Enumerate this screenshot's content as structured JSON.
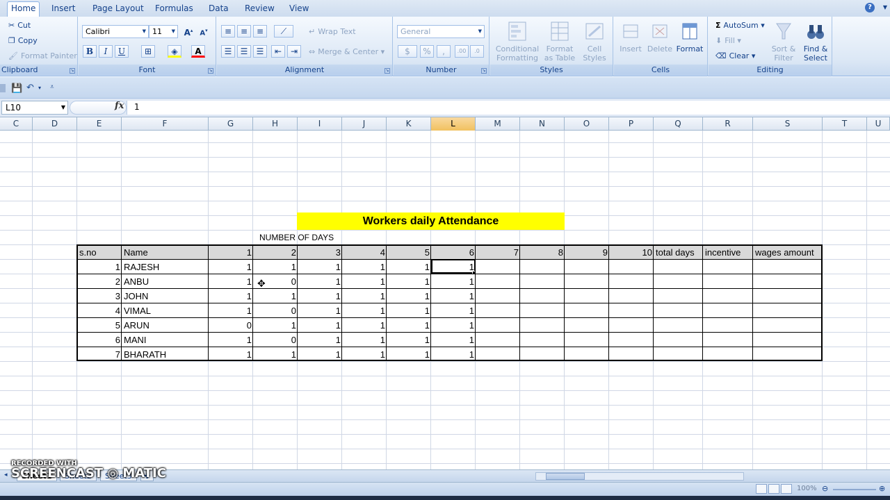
{
  "ribbon_tabs": [
    "Home",
    "Insert",
    "Page Layout",
    "Formulas",
    "Data",
    "Review",
    "View"
  ],
  "clipboard": {
    "cut": "Cut",
    "copy": "Copy",
    "format_painter": "Format Painter",
    "label": "Clipboard"
  },
  "font": {
    "name": "Calibri",
    "size": "11",
    "label": "Font",
    "bold": "B",
    "italic": "I",
    "underline": "U"
  },
  "alignment": {
    "wrap_text": "Wrap Text",
    "merge_center": "Merge & Center",
    "label": "Alignment"
  },
  "number": {
    "format": "General",
    "currency": "$",
    "percent": "%",
    "comma": ",",
    "label": "Number"
  },
  "styles": {
    "conditional": "Conditional\nFormatting",
    "format_table": "Format\nas Table",
    "cell_styles": "Cell\nStyles",
    "label": "Styles"
  },
  "cells": {
    "insert": "Insert",
    "delete": "Delete",
    "format": "Format",
    "label": "Cells"
  },
  "editing": {
    "autosum": "AutoSum",
    "fill": "Fill",
    "clear": "Clear",
    "sort_filter": "Sort &\nFilter",
    "find_select": "Find &\nSelect",
    "label": "Editing"
  },
  "formula_bar": {
    "name_box": "L10",
    "fx": "fx",
    "value": "1"
  },
  "column_headers": [
    {
      "id": "C",
      "sel": false
    },
    {
      "id": "D",
      "sel": false
    },
    {
      "id": "E",
      "sel": false
    },
    {
      "id": "F",
      "sel": false
    },
    {
      "id": "G",
      "sel": false
    },
    {
      "id": "H",
      "sel": false
    },
    {
      "id": "I",
      "sel": false
    },
    {
      "id": "J",
      "sel": false
    },
    {
      "id": "K",
      "sel": false
    },
    {
      "id": "L",
      "sel": true
    },
    {
      "id": "M",
      "sel": false
    },
    {
      "id": "N",
      "sel": false
    },
    {
      "id": "O",
      "sel": false
    },
    {
      "id": "P",
      "sel": false
    },
    {
      "id": "Q",
      "sel": false
    },
    {
      "id": "R",
      "sel": false
    },
    {
      "id": "S",
      "sel": false
    },
    {
      "id": "T",
      "sel": false
    },
    {
      "id": "U",
      "sel": false
    }
  ],
  "sheet": {
    "title": "Workers daily Attendance",
    "subtitle": "NUMBER OF DAYS",
    "header": [
      "s.no",
      "Name",
      "1",
      "2",
      "3",
      "4",
      "5",
      "6",
      "7",
      "8",
      "9",
      "10",
      "total days",
      "incentive",
      "wages amount"
    ],
    "rows": [
      {
        "sno": "1",
        "name": "RAJESH",
        "days": [
          "1",
          "1",
          "1",
          "1",
          "1",
          "1"
        ]
      },
      {
        "sno": "2",
        "name": "ANBU",
        "days": [
          "1",
          "0",
          "1",
          "1",
          "1",
          "1"
        ]
      },
      {
        "sno": "3",
        "name": "JOHN",
        "days": [
          "1",
          "1",
          "1",
          "1",
          "1",
          "1"
        ]
      },
      {
        "sno": "4",
        "name": "VIMAL",
        "days": [
          "1",
          "0",
          "1",
          "1",
          "1",
          "1"
        ]
      },
      {
        "sno": "5",
        "name": "ARUN",
        "days": [
          "0",
          "1",
          "1",
          "1",
          "1",
          "1"
        ]
      },
      {
        "sno": "6",
        "name": "MANI",
        "days": [
          "1",
          "0",
          "1",
          "1",
          "1",
          "1"
        ]
      },
      {
        "sno": "7",
        "name": "BHARATH",
        "days": [
          "1",
          "1",
          "1",
          "1",
          "1",
          "1"
        ]
      }
    ]
  },
  "sheet_tabs": [
    "Sheet1",
    "Sheet2",
    "Sheet3"
  ],
  "zoom": "100%",
  "watermark": {
    "line1": "RECORDED WITH",
    "line2": "SCREENCAST ◎ MATIC"
  },
  "colors": {
    "title_fill": "#ffff00",
    "header_fill": "#d9d9d9",
    "selected_col": "#f1c15f",
    "ribbon": "#dbe7f5"
  }
}
